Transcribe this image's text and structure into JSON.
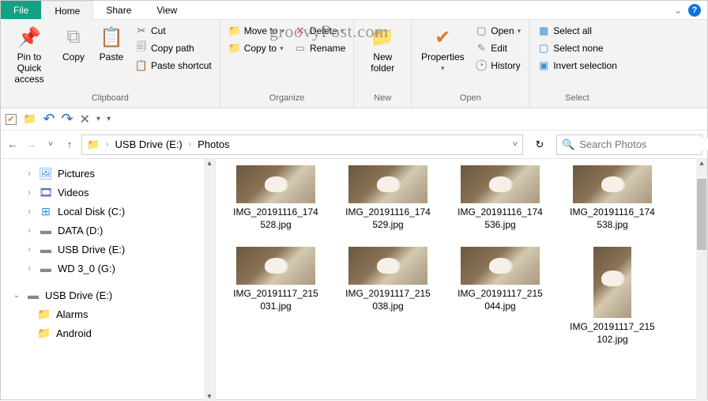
{
  "watermark": "groovyPost.com",
  "tabs": {
    "file": "File",
    "home": "Home",
    "share": "Share",
    "view": "View"
  },
  "ribbon": {
    "clipboard": {
      "label": "Clipboard",
      "pin": "Pin to Quick access",
      "copy": "Copy",
      "paste": "Paste",
      "cut": "Cut",
      "copy_path": "Copy path",
      "paste_shortcut": "Paste shortcut"
    },
    "organize": {
      "label": "Organize",
      "move_to": "Move to",
      "copy_to": "Copy to",
      "delete": "Delete",
      "rename": "Rename"
    },
    "new": {
      "label": "New",
      "new_folder": "New folder"
    },
    "open": {
      "label": "Open",
      "properties": "Properties",
      "open": "Open",
      "edit": "Edit",
      "history": "History"
    },
    "select": {
      "label": "Select",
      "select_all": "Select all",
      "select_none": "Select none",
      "invert": "Invert selection"
    }
  },
  "breadcrumb": {
    "drive": "USB Drive (E:)",
    "folder": "Photos"
  },
  "search": {
    "placeholder": "Search Photos"
  },
  "nav": [
    {
      "label": "Pictures",
      "icon": "pictures"
    },
    {
      "label": "Videos",
      "icon": "videos"
    },
    {
      "label": "Local Disk (C:)",
      "icon": "osdisk"
    },
    {
      "label": "DATA (D:)",
      "icon": "disk"
    },
    {
      "label": "USB Drive (E:)",
      "icon": "disk"
    },
    {
      "label": "WD 3_0 (G:)",
      "icon": "disk"
    }
  ],
  "nav2": {
    "root": "USB Drive (E:)",
    "children": [
      {
        "label": "Alarms"
      },
      {
        "label": "Android"
      }
    ]
  },
  "files": [
    {
      "name": "IMG_20191116_174528.jpg",
      "orient": "land"
    },
    {
      "name": "IMG_20191116_174529.jpg",
      "orient": "land"
    },
    {
      "name": "IMG_20191116_174536.jpg",
      "orient": "land"
    },
    {
      "name": "IMG_20191116_174538.jpg",
      "orient": "land"
    },
    {
      "name": "IMG_20191117_215031.jpg",
      "orient": "land"
    },
    {
      "name": "IMG_20191117_215038.jpg",
      "orient": "land"
    },
    {
      "name": "IMG_20191117_215044.jpg",
      "orient": "land"
    },
    {
      "name": "IMG_20191117_215102.jpg",
      "orient": "port"
    }
  ]
}
